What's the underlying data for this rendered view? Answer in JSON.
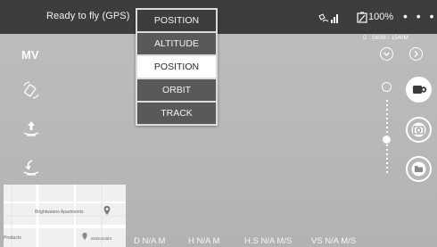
{
  "topbar": {
    "status": "Ready to fly (GPS)",
    "battery_text": "100%",
    "more": "• • •"
  },
  "mode_dropdown": {
    "selected": "POSITION",
    "options": [
      {
        "label": "ALTITUDE"
      },
      {
        "label": "POSITION"
      },
      {
        "label": "ORBIT"
      },
      {
        "label": "TRACK"
      }
    ]
  },
  "readouts": {
    "distance": "D : 560M / 1540M"
  },
  "left_panel": {
    "mode_label": "MV"
  },
  "map": {
    "label_apartments": "Brightwaters Apartments",
    "label_restaurant": "McDonald's",
    "label_products": "Products"
  },
  "telemetry": {
    "d": "D N/A M",
    "h": "H N/A M",
    "hs": "H.S N/A M/S",
    "vs": "VS  N/A M/S"
  },
  "colors": {
    "topbar_bg": "#3d3d3d",
    "dropdown_item_bg": "#595959",
    "dropdown_active_bg": "#ffffff",
    "camera_bg": "#b8b8b8"
  }
}
